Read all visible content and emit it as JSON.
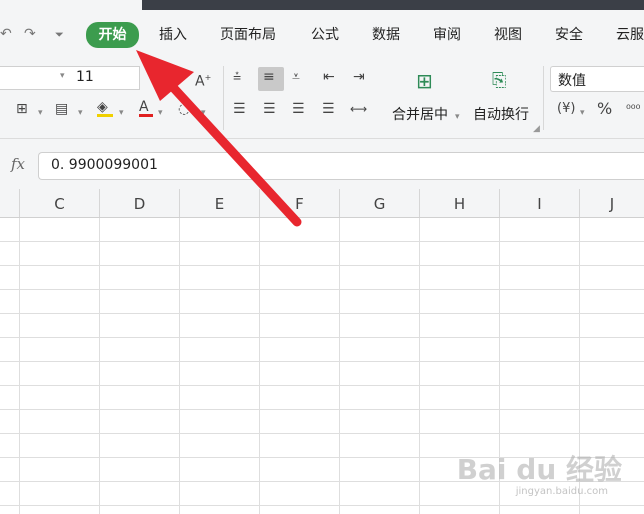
{
  "ribbon_tabs": [
    {
      "label": "开始",
      "active": true
    },
    {
      "label": "插入"
    },
    {
      "label": "页面布局"
    },
    {
      "label": "公式"
    },
    {
      "label": "数据"
    },
    {
      "label": "审阅"
    },
    {
      "label": "视图"
    },
    {
      "label": "安全"
    },
    {
      "label": "云服"
    }
  ],
  "font": {
    "size": "11"
  },
  "alignment": {
    "merge_label": "合并居中",
    "wrap_label": "自动换行"
  },
  "number": {
    "format": "数值",
    "percent_symbol": "%",
    "currency_symbol": "¥"
  },
  "formula_bar": {
    "fx_label": "fx",
    "value": "0. 9900099001"
  },
  "columns": [
    "C",
    "D",
    "E",
    "F",
    "G",
    "H",
    "I",
    "J"
  ],
  "watermark": {
    "brand": "Bai du 经验",
    "url": "jingyan.baidu.com"
  },
  "colors": {
    "active_tab": "#3c9c4e",
    "arrow": "#e8262e",
    "ribbon_bg": "#f4f5f6"
  }
}
